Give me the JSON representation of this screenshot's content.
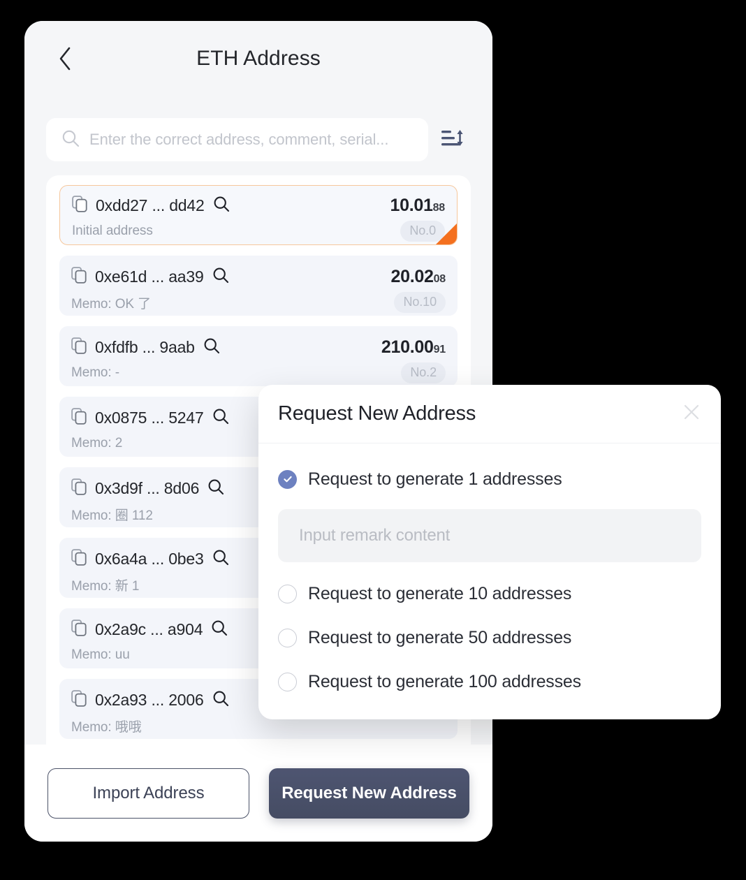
{
  "header": {
    "title": "ETH Address",
    "back_icon": "chevron-left-icon"
  },
  "search": {
    "placeholder": "Enter the correct address, comment, serial...",
    "value": "",
    "icon": "search-icon",
    "sort_icon": "sort-icon"
  },
  "address_list": [
    {
      "address": "0xdd27 ... dd42",
      "amount_main": "10.01",
      "amount_frac": "88",
      "memo": "Initial address",
      "serial": "No.0",
      "active": true
    },
    {
      "address": "0xe61d ... aa39",
      "amount_main": "20.02",
      "amount_frac": "08",
      "memo": "Memo: OK 了",
      "serial": "No.10",
      "active": false
    },
    {
      "address": "0xfdfb ... 9aab",
      "amount_main": "210.00",
      "amount_frac": "91",
      "memo": "Memo: -",
      "serial": "No.2",
      "active": false
    },
    {
      "address": "0x0875 ... 5247",
      "amount_main": "",
      "amount_frac": "",
      "memo": "Memo: 2",
      "serial": "",
      "active": false
    },
    {
      "address": "0x3d9f ... 8d06",
      "amount_main": "",
      "amount_frac": "",
      "memo": "Memo: 圈 112",
      "serial": "",
      "active": false
    },
    {
      "address": "0x6a4a ... 0be3",
      "amount_main": "",
      "amount_frac": "",
      "memo": "Memo: 新 1",
      "serial": "",
      "active": false
    },
    {
      "address": "0x2a9c ... a904",
      "amount_main": "",
      "amount_frac": "",
      "memo": "Memo: uu",
      "serial": "",
      "active": false
    },
    {
      "address": "0x2a93 ... 2006",
      "amount_main": "",
      "amount_frac": "",
      "memo": "Memo: 哦哦",
      "serial": "",
      "active": false
    }
  ],
  "actions": {
    "import_label": "Import Address",
    "request_label": "Request New Address"
  },
  "modal": {
    "title": "Request New Address",
    "close_icon": "close-icon",
    "remark_placeholder": "Input remark content",
    "remark_value": "",
    "options": [
      {
        "label": "Request to generate 1 addresses",
        "selected": true
      },
      {
        "label": "Request to generate 10 addresses",
        "selected": false
      },
      {
        "label": "Request to generate 50 addresses",
        "selected": false
      },
      {
        "label": "Request to generate 100 addresses",
        "selected": false
      }
    ]
  },
  "colors": {
    "accent_orange": "#f4701f",
    "primary_navy": "#454c63",
    "radio_blue": "#6d81c0",
    "page_bg": "#f5f6f8",
    "row_bg": "#f3f5fa"
  }
}
